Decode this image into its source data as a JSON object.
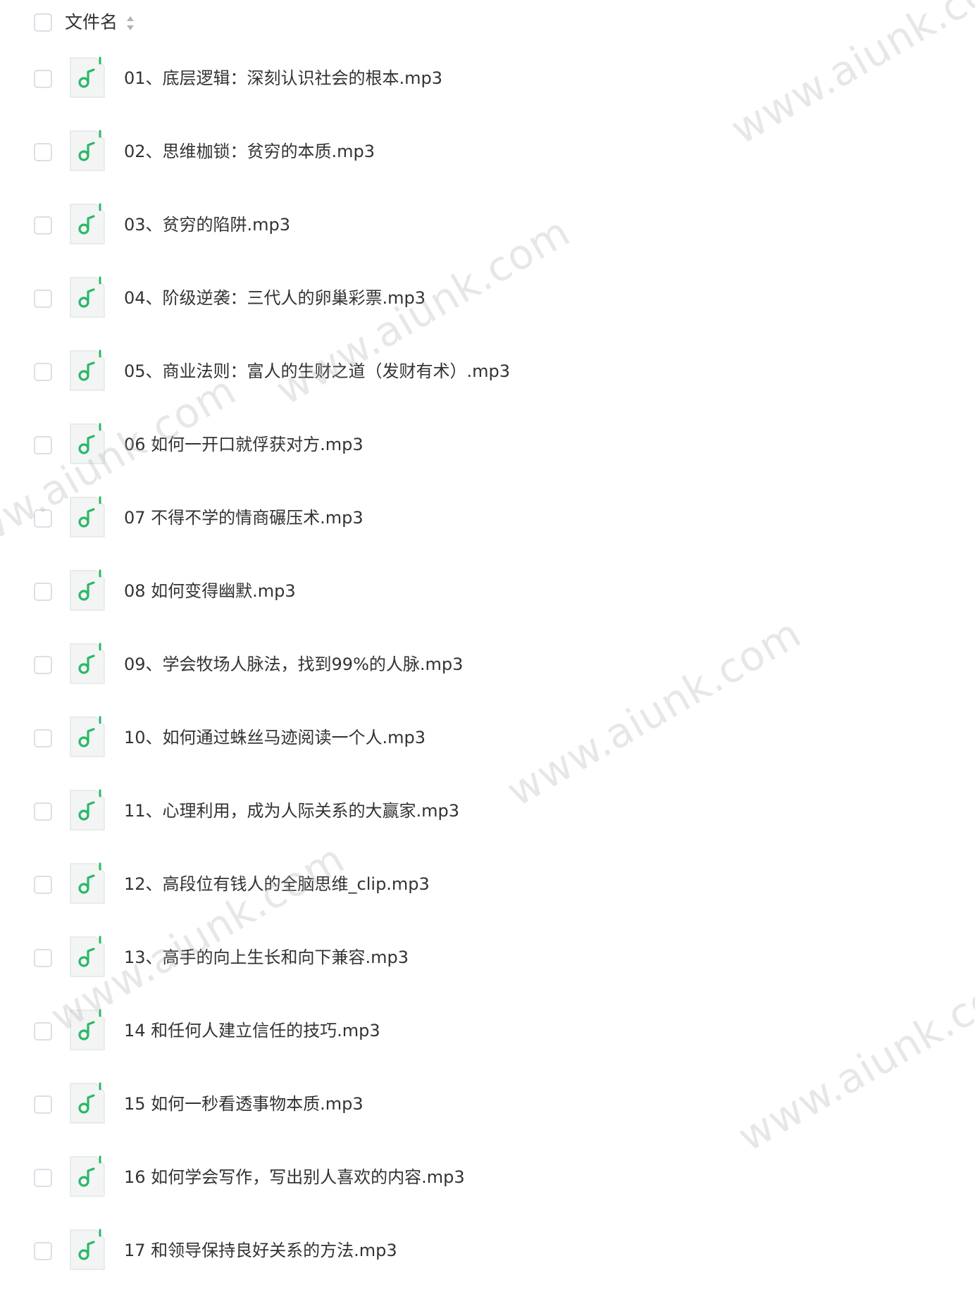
{
  "header": {
    "column_label": "文件名",
    "sort_icon": "sort-icon"
  },
  "file_icon": "music-note-icon",
  "accent_color": "#2ab868",
  "files": [
    {
      "name": "01、底层逻辑：深刻认识社会的根本.mp3"
    },
    {
      "name": "02、思维枷锁：贫穷的本质.mp3"
    },
    {
      "name": "03、贫穷的陷阱.mp3"
    },
    {
      "name": "04、阶级逆袭：三代人的卵巢彩票.mp3"
    },
    {
      "name": "05、商业法则：富人的生财之道（发财有术）.mp3"
    },
    {
      "name": "06 如何一开口就俘获对方.mp3"
    },
    {
      "name": "07 不得不学的情商碾压术.mp3"
    },
    {
      "name": "08 如何变得幽默.mp3"
    },
    {
      "name": "09、学会牧场人脉法，找到99%的人脉.mp3"
    },
    {
      "name": "10、如何通过蛛丝马迹阅读一个人.mp3"
    },
    {
      "name": "11、心理利用，成为人际关系的大赢家.mp3"
    },
    {
      "name": "12、高段位有钱人的全脑思维_clip.mp3"
    },
    {
      "name": "13、高手的向上生长和向下兼容.mp3"
    },
    {
      "name": "14 和任何人建立信任的技巧.mp3"
    },
    {
      "name": "15 如何一秒看透事物本质.mp3"
    },
    {
      "name": "16 如何学会写作，写出别人喜欢的内容.mp3"
    },
    {
      "name": "17 和领导保持良好关系的方法.mp3"
    }
  ],
  "watermark": "www.aiunk.com"
}
